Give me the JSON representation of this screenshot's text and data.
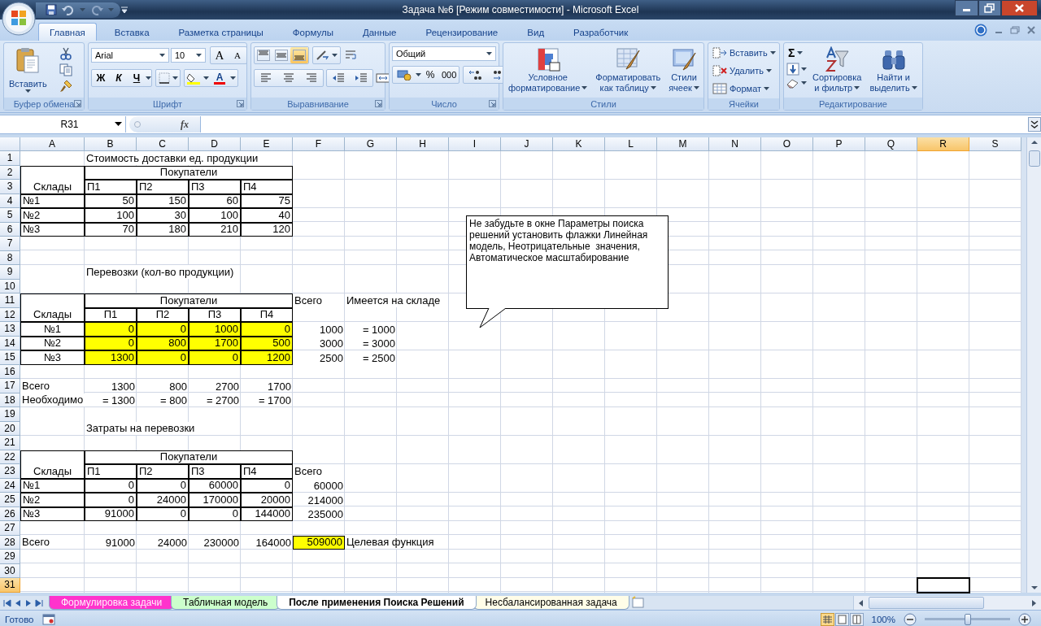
{
  "window": {
    "title": "Задача №6  [Режим совместимости] - Microsoft Excel"
  },
  "tabs": [
    {
      "label": "Главная",
      "selected": true
    },
    {
      "label": "Вставка",
      "selected": false
    },
    {
      "label": "Разметка страницы",
      "selected": false
    },
    {
      "label": "Формулы",
      "selected": false
    },
    {
      "label": "Данные",
      "selected": false
    },
    {
      "label": "Рецензирование",
      "selected": false
    },
    {
      "label": "Вид",
      "selected": false
    },
    {
      "label": "Разработчик",
      "selected": false
    }
  ],
  "ribbon": {
    "clipboard": {
      "title": "Буфер обмена",
      "paste": "Вставить"
    },
    "font": {
      "title": "Шрифт",
      "family": "Arial",
      "size": "10",
      "grow": "A",
      "shrink": "A",
      "bold": "Ж",
      "italic": "К",
      "underline": "Ч",
      "color_glyph": "A"
    },
    "alignment": {
      "title": "Выравнивание",
      "vertical": [
        {
          "kind": "top",
          "selected": false
        },
        {
          "kind": "middle",
          "selected": false
        },
        {
          "kind": "bottom",
          "selected": true
        }
      ]
    },
    "number": {
      "title": "Число",
      "format": "Общий",
      "percent": "%",
      "thousands": "000"
    },
    "styles": {
      "title": "Стили",
      "buttons": [
        {
          "kind": "conditional",
          "lines": [
            "Условное",
            "форматирование"
          ]
        },
        {
          "kind": "table",
          "lines": [
            "Форматировать",
            "как таблицу"
          ]
        },
        {
          "kind": "cell_styles",
          "lines": [
            "Стили",
            "ячеек"
          ]
        }
      ]
    },
    "cells": {
      "title": "Ячейки",
      "buttons": [
        {
          "kind": "insert",
          "label": "Вставить"
        },
        {
          "kind": "delete",
          "label": "Удалить"
        },
        {
          "kind": "format",
          "label": "Формат"
        }
      ]
    },
    "editing": {
      "title": "Редактирование",
      "sum": "Σ",
      "buttons": [
        {
          "kind": "sort",
          "lines": [
            "Сортировка",
            "и фильтр"
          ]
        },
        {
          "kind": "find",
          "lines": [
            "Найти и",
            "выделить"
          ]
        }
      ]
    }
  },
  "formula_bar": {
    "name_box": "R31",
    "fx": "fx"
  },
  "sheet": {
    "columns": [
      {
        "label": "A",
        "selected": false
      },
      {
        "label": "B",
        "selected": false
      },
      {
        "label": "C",
        "selected": false
      },
      {
        "label": "D",
        "selected": false
      },
      {
        "label": "E",
        "selected": false
      },
      {
        "label": "F",
        "selected": false
      },
      {
        "label": "G",
        "selected": false
      },
      {
        "label": "H",
        "selected": false
      },
      {
        "label": "I",
        "selected": false
      },
      {
        "label": "J",
        "selected": false
      },
      {
        "label": "K",
        "selected": false
      },
      {
        "label": "L",
        "selected": false
      },
      {
        "label": "M",
        "selected": false
      },
      {
        "label": "N",
        "selected": false
      },
      {
        "label": "O",
        "selected": false
      },
      {
        "label": "P",
        "selected": false
      },
      {
        "label": "Q",
        "selected": false
      },
      {
        "label": "R",
        "selected": true
      },
      {
        "label": "S",
        "selected": false
      }
    ],
    "rows": [
      {
        "label": "1",
        "selected": false
      },
      {
        "label": "2",
        "selected": false
      },
      {
        "label": "3",
        "selected": false
      },
      {
        "label": "4",
        "selected": false
      },
      {
        "label": "5",
        "selected": false
      },
      {
        "label": "6",
        "selected": false
      },
      {
        "label": "7",
        "selected": false
      },
      {
        "label": "8",
        "selected": false
      },
      {
        "label": "9",
        "selected": false
      },
      {
        "label": "10",
        "selected": false
      },
      {
        "label": "11",
        "selected": false
      },
      {
        "label": "12",
        "selected": false
      },
      {
        "label": "13",
        "selected": false
      },
      {
        "label": "14",
        "selected": false
      },
      {
        "label": "15",
        "selected": false
      },
      {
        "label": "16",
        "selected": false
      },
      {
        "label": "17",
        "selected": false
      },
      {
        "label": "18",
        "selected": false
      },
      {
        "label": "19",
        "selected": false
      },
      {
        "label": "20",
        "selected": false
      },
      {
        "label": "21",
        "selected": false
      },
      {
        "label": "22",
        "selected": false
      },
      {
        "label": "23",
        "selected": false
      },
      {
        "label": "24",
        "selected": false
      },
      {
        "label": "25",
        "selected": false
      },
      {
        "label": "26",
        "selected": false
      },
      {
        "label": "27",
        "selected": false
      },
      {
        "label": "28",
        "selected": false
      },
      {
        "label": "29",
        "selected": false
      },
      {
        "label": "30",
        "selected": false
      },
      {
        "label": "31",
        "selected": true
      }
    ],
    "cells": [
      {
        "text": "Стоимость доставки ед. продукции",
        "kind": "text",
        "bordered": false,
        "highlighted": false
      },
      {
        "text": "Склады",
        "kind": "centered",
        "bordered": true,
        "highlighted": false
      },
      {
        "text": "Покупатели",
        "kind": "centered",
        "bordered": true,
        "highlighted": false
      },
      {
        "text": "П1",
        "kind": "text",
        "bordered": true,
        "highlighted": false
      },
      {
        "text": "П2",
        "kind": "text",
        "bordered": true,
        "highlighted": false
      },
      {
        "text": "П3",
        "kind": "text",
        "bordered": true,
        "highlighted": false
      },
      {
        "text": "П4",
        "kind": "text",
        "bordered": true,
        "highlighted": false
      },
      {
        "text": "№1",
        "kind": "text",
        "bordered": true,
        "highlighted": false
      },
      {
        "text": "50",
        "kind": "number",
        "bordered": true,
        "highlighted": false
      },
      {
        "text": "150",
        "kind": "number",
        "bordered": true,
        "highlighted": false
      },
      {
        "text": "60",
        "kind": "number",
        "bordered": true,
        "highlighted": false
      },
      {
        "text": "75",
        "kind": "number",
        "bordered": true,
        "highlighted": false
      },
      {
        "text": "№2",
        "kind": "text",
        "bordered": true,
        "highlighted": false
      },
      {
        "text": "100",
        "kind": "number",
        "bordered": true,
        "highlighted": false
      },
      {
        "text": "30",
        "kind": "number",
        "bordered": true,
        "highlighted": false
      },
      {
        "text": "100",
        "kind": "number",
        "bordered": true,
        "highlighted": false
      },
      {
        "text": "40",
        "kind": "number",
        "bordered": true,
        "highlighted": false
      },
      {
        "text": "№3",
        "kind": "text",
        "bordered": true,
        "highlighted": false
      },
      {
        "text": "70",
        "kind": "number",
        "bordered": true,
        "highlighted": false
      },
      {
        "text": "180",
        "kind": "number",
        "bordered": true,
        "highlighted": false
      },
      {
        "text": "210",
        "kind": "number",
        "bordered": true,
        "highlighted": false
      },
      {
        "text": "120",
        "kind": "number",
        "bordered": true,
        "highlighted": false
      },
      {
        "text": "Перевозки (кол-во продукции)",
        "kind": "text",
        "bordered": false,
        "highlighted": false
      },
      {
        "text": "Склады",
        "kind": "centered",
        "bordered": true,
        "highlighted": false
      },
      {
        "text": "Покупатели",
        "kind": "centered",
        "bordered": true,
        "highlighted": false
      },
      {
        "text": "Всего",
        "kind": "text",
        "bordered": false,
        "highlighted": false
      },
      {
        "text": "Имеется на складе",
        "kind": "text",
        "bordered": false,
        "highlighted": false
      },
      {
        "text": "П1",
        "kind": "centered",
        "bordered": true,
        "highlighted": false
      },
      {
        "text": "П2",
        "kind": "centered",
        "bordered": true,
        "highlighted": false
      },
      {
        "text": "П3",
        "kind": "centered",
        "bordered": true,
        "highlighted": false
      },
      {
        "text": "П4",
        "kind": "centered",
        "bordered": true,
        "highlighted": false
      },
      {
        "text": "№1",
        "kind": "centered",
        "bordered": true,
        "highlighted": false
      },
      {
        "text": "0",
        "kind": "number",
        "bordered": true,
        "highlighted": true
      },
      {
        "text": "0",
        "kind": "number",
        "bordered": true,
        "highlighted": true
      },
      {
        "text": "1000",
        "kind": "number",
        "bordered": true,
        "highlighted": true
      },
      {
        "text": "0",
        "kind": "number",
        "bordered": true,
        "highlighted": true
      },
      {
        "text": "1000",
        "kind": "number",
        "bordered": false,
        "highlighted": false
      },
      {
        "text": "= 1000",
        "kind": "number",
        "bordered": false,
        "highlighted": false
      },
      {
        "text": "№2",
        "kind": "centered",
        "bordered": true,
        "highlighted": false
      },
      {
        "text": "0",
        "kind": "number",
        "bordered": true,
        "highlighted": true
      },
      {
        "text": "800",
        "kind": "number",
        "bordered": true,
        "highlighted": true
      },
      {
        "text": "1700",
        "kind": "number",
        "bordered": true,
        "highlighted": true
      },
      {
        "text": "500",
        "kind": "number",
        "bordered": true,
        "highlighted": true
      },
      {
        "text": "3000",
        "kind": "number",
        "bordered": false,
        "highlighted": false
      },
      {
        "text": "= 3000",
        "kind": "number",
        "bordered": false,
        "highlighted": false
      },
      {
        "text": "№3",
        "kind": "centered",
        "bordered": true,
        "highlighted": false
      },
      {
        "text": "1300",
        "kind": "number",
        "bordered": true,
        "highlighted": true
      },
      {
        "text": "0",
        "kind": "number",
        "bordered": true,
        "highlighted": true
      },
      {
        "text": "0",
        "kind": "number",
        "bordered": true,
        "highlighted": true
      },
      {
        "text": "1200",
        "kind": "number",
        "bordered": true,
        "highlighted": true
      },
      {
        "text": "2500",
        "kind": "number",
        "bordered": false,
        "highlighted": false
      },
      {
        "text": "= 2500",
        "kind": "number",
        "bordered": false,
        "highlighted": false
      },
      {
        "text": "Всего",
        "kind": "text",
        "bordered": false,
        "highlighted": false
      },
      {
        "text": "1300",
        "kind": "number",
        "bordered": false,
        "highlighted": false
      },
      {
        "text": "800",
        "kind": "number",
        "bordered": false,
        "highlighted": false
      },
      {
        "text": "2700",
        "kind": "number",
        "bordered": false,
        "highlighted": false
      },
      {
        "text": "1700",
        "kind": "number",
        "bordered": false,
        "highlighted": false
      },
      {
        "text": "Необходимо",
        "kind": "text",
        "bordered": false,
        "highlighted": false
      },
      {
        "text": "= 1300",
        "kind": "number",
        "bordered": false,
        "highlighted": false
      },
      {
        "text": "= 800",
        "kind": "number",
        "bordered": false,
        "highlighted": false
      },
      {
        "text": "= 2700",
        "kind": "number",
        "bordered": false,
        "highlighted": false
      },
      {
        "text": "= 1700",
        "kind": "number",
        "bordered": false,
        "highlighted": false
      },
      {
        "text": "Затраты на перевозки",
        "kind": "text",
        "bordered": false,
        "highlighted": false
      },
      {
        "text": "Склады",
        "kind": "centered",
        "bordered": true,
        "highlighted": false
      },
      {
        "text": "Покупатели",
        "kind": "centered",
        "bordered": true,
        "highlighted": false
      },
      {
        "text": "П1",
        "kind": "text",
        "bordered": true,
        "highlighted": false
      },
      {
        "text": "П2",
        "kind": "text",
        "bordered": true,
        "highlighted": false
      },
      {
        "text": "П3",
        "kind": "text",
        "bordered": true,
        "highlighted": false
      },
      {
        "text": "П4",
        "kind": "text",
        "bordered": true,
        "highlighted": false
      },
      {
        "text": "Всего",
        "kind": "text",
        "bordered": false,
        "highlighted": false
      },
      {
        "text": "№1",
        "kind": "text",
        "bordered": true,
        "highlighted": false
      },
      {
        "text": "0",
        "kind": "number",
        "bordered": true,
        "highlighted": false
      },
      {
        "text": "0",
        "kind": "number",
        "bordered": true,
        "highlighted": false
      },
      {
        "text": "60000",
        "kind": "number",
        "bordered": true,
        "highlighted": false
      },
      {
        "text": "0",
        "kind": "number",
        "bordered": true,
        "highlighted": false
      },
      {
        "text": "60000",
        "kind": "number",
        "bordered": false,
        "highlighted": false
      },
      {
        "text": "№2",
        "kind": "text",
        "bordered": true,
        "highlighted": false
      },
      {
        "text": "0",
        "kind": "number",
        "bordered": true,
        "highlighted": false
      },
      {
        "text": "24000",
        "kind": "number",
        "bordered": true,
        "highlighted": false
      },
      {
        "text": "170000",
        "kind": "number",
        "bordered": true,
        "highlighted": false
      },
      {
        "text": "20000",
        "kind": "number",
        "bordered": true,
        "highlighted": false
      },
      {
        "text": "214000",
        "kind": "number",
        "bordered": false,
        "highlighted": false
      },
      {
        "text": "№3",
        "kind": "text",
        "bordered": true,
        "highlighted": false
      },
      {
        "text": "91000",
        "kind": "number",
        "bordered": true,
        "highlighted": false
      },
      {
        "text": "0",
        "kind": "number",
        "bordered": true,
        "highlighted": false
      },
      {
        "text": "0",
        "kind": "number",
        "bordered": true,
        "highlighted": false
      },
      {
        "text": "144000",
        "kind": "number",
        "bordered": true,
        "highlighted": false
      },
      {
        "text": "235000",
        "kind": "number",
        "bordered": false,
        "highlighted": false
      },
      {
        "text": "Всего",
        "kind": "text",
        "bordered": false,
        "highlighted": false
      },
      {
        "text": "91000",
        "kind": "number",
        "bordered": false,
        "highlighted": false
      },
      {
        "text": "24000",
        "kind": "number",
        "bordered": false,
        "highlighted": false
      },
      {
        "text": "230000",
        "kind": "number",
        "bordered": false,
        "highlighted": false
      },
      {
        "text": "164000",
        "kind": "number",
        "bordered": false,
        "highlighted": false
      },
      {
        "text": "509000",
        "kind": "number",
        "bordered": true,
        "highlighted": true
      },
      {
        "text": "Целевая функция",
        "kind": "text",
        "bordered": false,
        "highlighted": false
      }
    ],
    "comment": "Не забудьте в окне Параметры поиска решений установить флажки Линейная модель, Неотрицательные  значения, Автоматическое масштабирование"
  },
  "sheet_tabs": [
    {
      "label": "Формулировка задачи",
      "selected": false,
      "color": "#ff33cc"
    },
    {
      "label": "Табличная модель",
      "selected": false,
      "color": "#ccffcc"
    },
    {
      "label": "После применения Поиска Решений",
      "selected": true
    },
    {
      "label": "Несбалансированная задача",
      "selected": false
    }
  ],
  "status_bar": {
    "status": "Готово",
    "zoom": "100%",
    "zoom_slider": {
      "level": 0.5
    }
  }
}
